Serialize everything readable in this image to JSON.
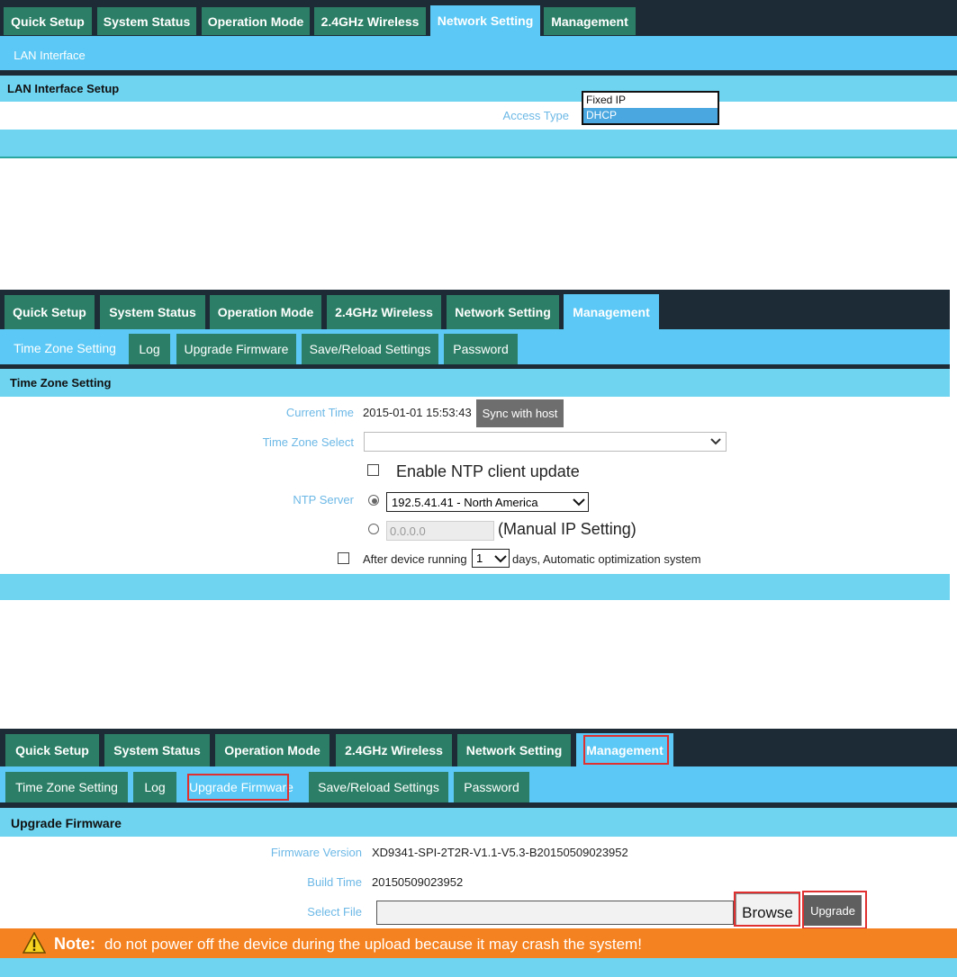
{
  "panel1": {
    "tabs": [
      "Quick Setup",
      "System Status",
      "Operation Mode",
      "2.4GHz Wireless",
      "Network Setting",
      "Management"
    ],
    "active_tab": "Network Setting",
    "subtabs": [
      "LAN Interface"
    ],
    "section_title": "LAN Interface Setup",
    "access_type_label": "Access Type",
    "dropdown_options": [
      "Fixed IP",
      "DHCP"
    ],
    "dropdown_selected": "DHCP"
  },
  "panel2": {
    "tabs": [
      "Quick Setup",
      "System Status",
      "Operation Mode",
      "2.4GHz Wireless",
      "Network Setting",
      "Management"
    ],
    "active_tab": "Management",
    "subtabs": [
      "Time Zone Setting",
      "Log",
      "Upgrade Firmware",
      "Save/Reload Settings",
      "Password"
    ],
    "active_subtab": "Time Zone Setting",
    "section_title": "Time Zone Setting",
    "current_time_label": "Current Time",
    "current_time_value": "2015-01-01 15:53:43",
    "sync_button": "Sync with host",
    "time_zone_label": "Time Zone Select",
    "ntp_enable_label": "Enable NTP client update",
    "ntp_server_label": "NTP Server",
    "ntp_server_value": "192.5.41.41 - North America",
    "manual_ip_value": "0.0.0.0",
    "manual_ip_label": "(Manual IP Setting)",
    "after_running_label": "After device running",
    "days_value": "1",
    "days_suffix": "days, Automatic optimization system"
  },
  "panel3": {
    "tabs": [
      "Quick Setup",
      "System Status",
      "Operation Mode",
      "2.4GHz Wireless",
      "Network Setting",
      "Management"
    ],
    "active_tab": "Management",
    "subtabs": [
      "Time Zone Setting",
      "Log",
      "Upgrade Firmware",
      "Save/Reload Settings",
      "Password"
    ],
    "active_subtab": "Upgrade Firmware",
    "section_title": "Upgrade Firmware",
    "firmware_version_label": "Firmware Version",
    "firmware_version_value": "XD9341-SPI-2T2R-V1.1-V5.3-B20150509023952",
    "build_time_label": "Build Time",
    "build_time_value": "20150509023952",
    "select_file_label": "Select File",
    "browse_button": "Browse",
    "upgrade_button": "Upgrade",
    "note_label": "Note:",
    "note_text": "do not power off the device during the upload because it may crash the system!"
  },
  "colors": {
    "nav_dark": "#1d2b36",
    "tab_green": "#2c7f66",
    "active_blue": "#5bc8f5",
    "band_blue": "#6fd4f0",
    "label_blue": "#6cb8e6",
    "note_orange": "#f58220",
    "highlight_red": "#e03030"
  },
  "icons": [
    "warning-icon",
    "chevron-down-icon"
  ]
}
